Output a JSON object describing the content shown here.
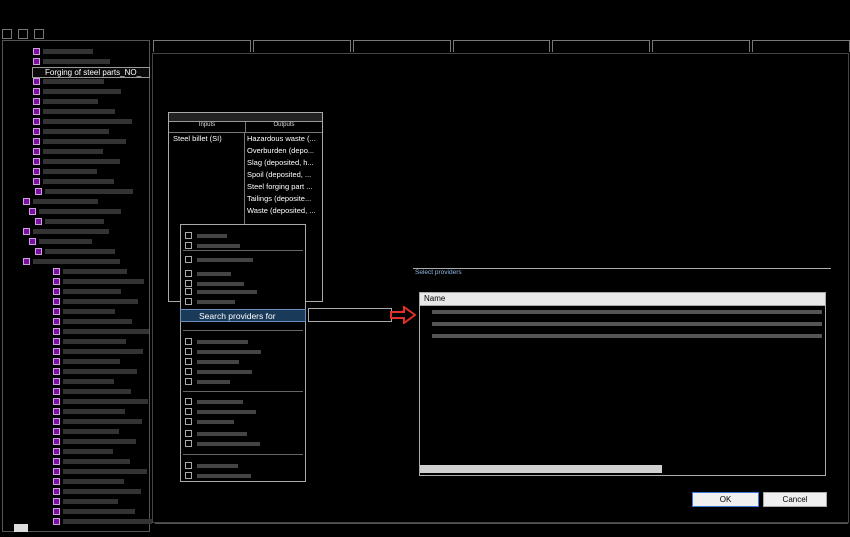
{
  "process_box": {
    "inputs_header": "Inputs",
    "outputs_header": "Outputs",
    "inputs": [
      "Steel billet (SI)"
    ],
    "outputs": [
      "Hazardous waste (...",
      "Overburden (depo...",
      "Slag (deposited, h...",
      "Spoil (deposited, ...",
      "Steel forging part ...",
      "Tailings (deposite...",
      "Waste (deposited, ..."
    ]
  },
  "tree": {
    "selected_label": "Forging of steel parts_NO_"
  },
  "context_menu": {
    "highlighted_label": "Search providers for"
  },
  "dialog": {
    "title": "Select providers",
    "column_header": "Name",
    "ok_label": "OK",
    "cancel_label": "Cancel"
  },
  "colors": {
    "accent": "#3a78d8",
    "process_icon": "#7a0fa0",
    "arrow": "#e0302a"
  }
}
